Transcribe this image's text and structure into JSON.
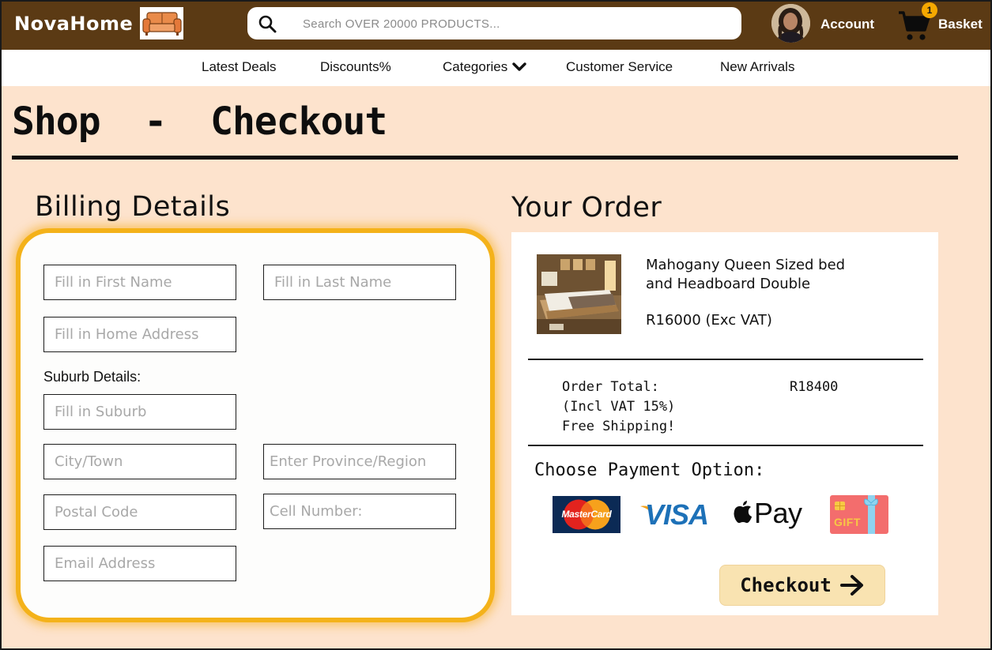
{
  "header": {
    "brand": "NovaHome",
    "brand_logo_icon": "sofa-icon",
    "search_placeholder": "Search OVER 20000 PRODUCTS...",
    "account_label": "Account",
    "basket_label": "Basket",
    "basket_count": "1",
    "colors": {
      "bar": "#5b3a14",
      "badge": "#f5a800"
    }
  },
  "nav": {
    "items": [
      "Latest Deals",
      "Discounts%",
      "Categories",
      "Customer Service",
      "New Arrivals"
    ]
  },
  "page": {
    "title": "Shop  -  Checkout",
    "background": "#fde3cd"
  },
  "billing": {
    "title": "Billing Details",
    "first_name_placeholder": "Fill in First Name",
    "last_name_placeholder": "Fill in Last Name",
    "address_placeholder": "Fill in Home Address",
    "suburb_label": "Suburb Details:",
    "suburb_placeholder": "Fill in Suburb",
    "city_placeholder": "City/Town",
    "province_placeholder": "Enter Province/Region",
    "postal_placeholder": "Postal Code",
    "cell_placeholder": "Cell Number:",
    "email_placeholder": "Email Address",
    "highlight_color": "#f4b21a"
  },
  "order": {
    "title": "Your Order",
    "product_name_line1": "Mahogany Queen Sized bed",
    "product_name_line2": "and Headboard Double",
    "product_price": "R16000 (Exc VAT)",
    "total_label": "Order Total:",
    "total_value": "R18400",
    "vat_note": "(Incl VAT 15%)",
    "shipping_note": "Free Shipping!",
    "payment_title": "Choose Payment Option:",
    "payment_options": [
      {
        "name": "mastercard",
        "label": "MasterCard"
      },
      {
        "name": "visa",
        "label": "VISA"
      },
      {
        "name": "apple-pay",
        "label": "Pay"
      },
      {
        "name": "gift-card",
        "label": "GIFT"
      }
    ],
    "checkout_label": "Checkout"
  }
}
